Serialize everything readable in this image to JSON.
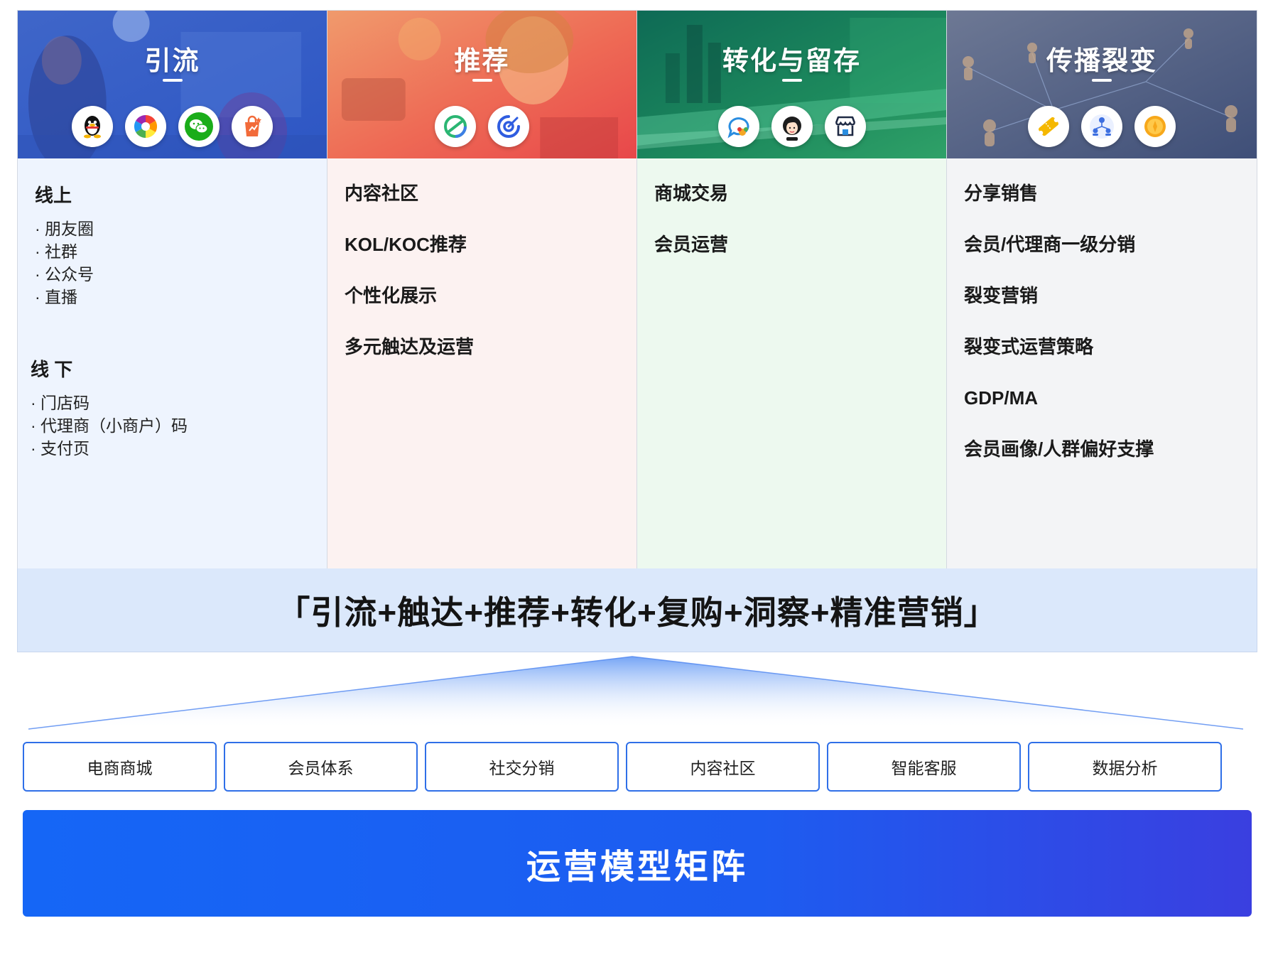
{
  "columns": [
    {
      "title": "引流",
      "icons": [
        "qq-icon",
        "camera-aperture-icon",
        "wechat-icon",
        "shopping-bag-icon"
      ],
      "groups": [
        {
          "title": "线上",
          "items": [
            "· 朋友圈",
            "· 社群",
            "· 公众号",
            "· 直播"
          ]
        },
        {
          "title": "线 下",
          "items": [
            "· 门店码",
            "· 代理商（小商户）码",
            "· 支付页"
          ]
        }
      ]
    },
    {
      "title": "推荐",
      "icons": [
        "recommend-icon",
        "target-icon"
      ],
      "items": [
        "内容社区",
        "KOL/KOC推荐",
        "个性化展示",
        "多元触达及运营"
      ]
    },
    {
      "title": "转化与留存",
      "icons": [
        "chat-bubble-icon",
        "customer-service-icon",
        "store-icon"
      ],
      "items": [
        "商城交易",
        "会员运营"
      ]
    },
    {
      "title": "传播裂变",
      "icons": [
        "coupon-icon",
        "network-users-icon",
        "coin-icon"
      ],
      "items": [
        "分享销售",
        "会员/代理商一级分销",
        "裂变营销",
        "裂变式运营策略",
        "GDP/MA",
        "会员画像/人群偏好支撑"
      ]
    }
  ],
  "slogan": "「引流+触达+推荐+转化+复购+洞察+精准营销」",
  "modules": [
    "电商商城",
    "会员体系",
    "社交分销",
    "内容社区",
    "智能客服",
    "数据分析"
  ],
  "footer": "运营模型矩阵",
  "colors": {
    "accent_blue": "#1566f6",
    "col1_bg": "#eef4fe",
    "col2_bg": "#fcf2f1",
    "col3_bg": "#edf9ef",
    "col4_bg": "#f3f4f6",
    "slogan_band": "#dbe8fb"
  }
}
